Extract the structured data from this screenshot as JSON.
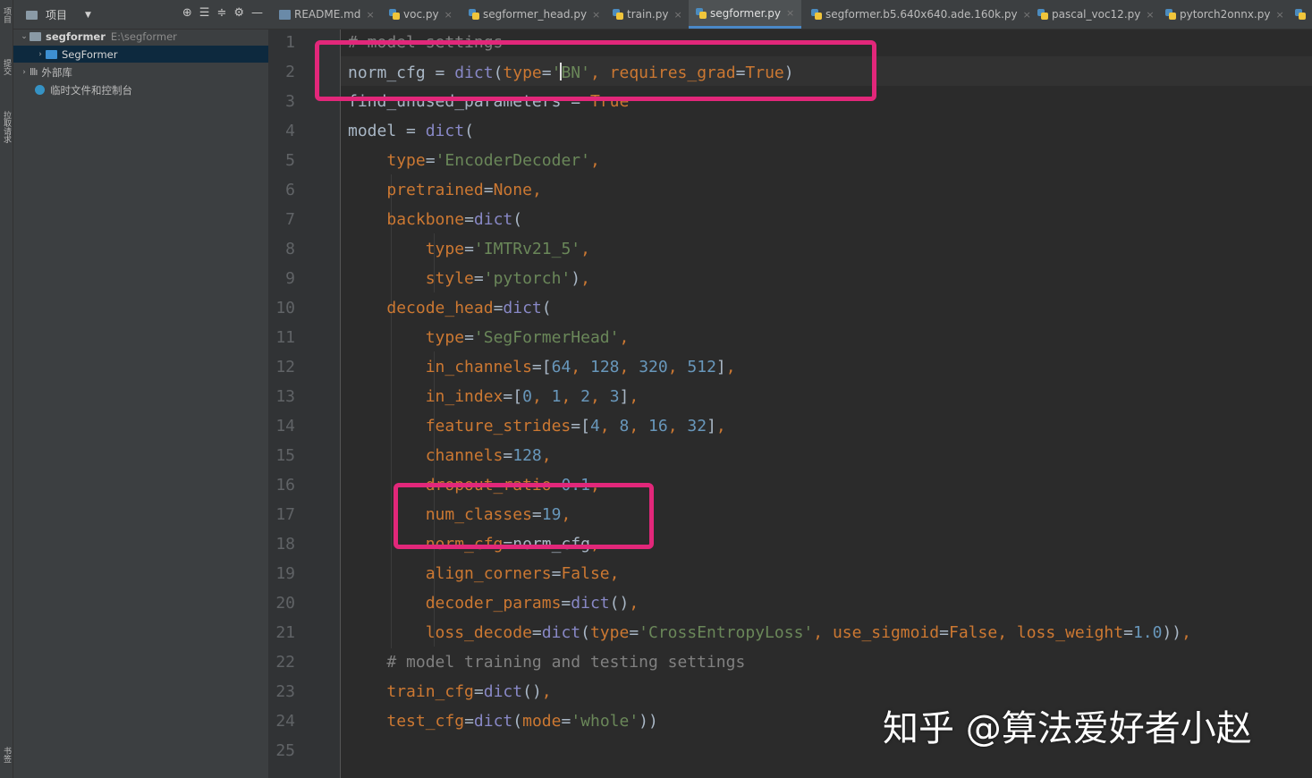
{
  "strip": {
    "labels": [
      "项目",
      "提交",
      "拉取请求",
      "书签"
    ]
  },
  "panel": {
    "title": "项目",
    "tree": [
      {
        "label": "segformer",
        "path": "E:\\segformer"
      },
      {
        "label": "SegFormer"
      },
      {
        "label": "外部库"
      },
      {
        "label": "临时文件和控制台"
      }
    ]
  },
  "tabs": [
    {
      "label": "README.md",
      "kind": "md"
    },
    {
      "label": "voc.py",
      "kind": "py"
    },
    {
      "label": "segformer_head.py",
      "kind": "py"
    },
    {
      "label": "train.py",
      "kind": "py"
    },
    {
      "label": "segformer.py",
      "kind": "py",
      "active": true
    },
    {
      "label": "segformer.b5.640x640.ade.160k.py",
      "kind": "py"
    },
    {
      "label": "pascal_voc12.py",
      "kind": "py"
    },
    {
      "label": "pytorch2onnx.py",
      "kind": "py"
    }
  ],
  "editor": {
    "line_numbers": [
      "1",
      "2",
      "3",
      "4",
      "5",
      "6",
      "7",
      "8",
      "9",
      "10",
      "11",
      "12",
      "13",
      "14",
      "15",
      "16",
      "17",
      "18",
      "19",
      "20",
      "21",
      "22",
      "23",
      "24",
      "25"
    ],
    "lines": [
      "# model settings",
      "norm_cfg = dict(type='BN', requires_grad=True)",
      "find_unused_parameters = True",
      "model = dict(",
      "    type='EncoderDecoder',",
      "    pretrained=None,",
      "    backbone=dict(",
      "        type='IMTRv21_5',",
      "        style='pytorch'),",
      "    decode_head=dict(",
      "        type='SegFormerHead',",
      "        in_channels=[64, 128, 320, 512],",
      "        in_index=[0, 1, 2, 3],",
      "        feature_strides=[4, 8, 16, 32],",
      "        channels=128,",
      "        dropout_ratio=0.1,",
      "        num_classes=19,",
      "        norm_cfg=norm_cfg,",
      "        align_corners=False,",
      "        decoder_params=dict(),",
      "        loss_decode=dict(type='CrossEntropyLoss', use_sigmoid=False, loss_weight=1.0)),",
      "    # model training and testing settings",
      "    train_cfg=dict(),",
      "    test_cfg=dict(mode='whole'))",
      ""
    ]
  },
  "colors": {
    "highlight_box": "#e2277a",
    "keyword_arg": "#cc7832",
    "string": "#6a8759",
    "number": "#6897bb"
  },
  "watermark": "知乎 @算法爱好者小赵"
}
